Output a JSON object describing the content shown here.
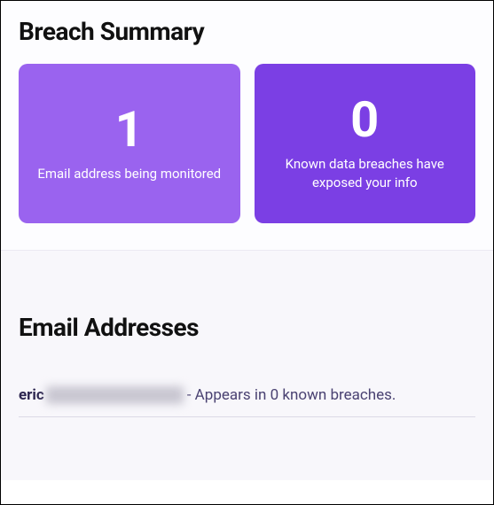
{
  "summary": {
    "title": "Breach Summary",
    "cards": [
      {
        "value": "1",
        "label": "Email address being monitored"
      },
      {
        "value": "0",
        "label": "Known data breaches have exposed your info"
      }
    ]
  },
  "emails": {
    "title": "Email Addresses",
    "items": [
      {
        "prefix": "eric",
        "status": " - Appears in 0 known breaches."
      }
    ]
  }
}
